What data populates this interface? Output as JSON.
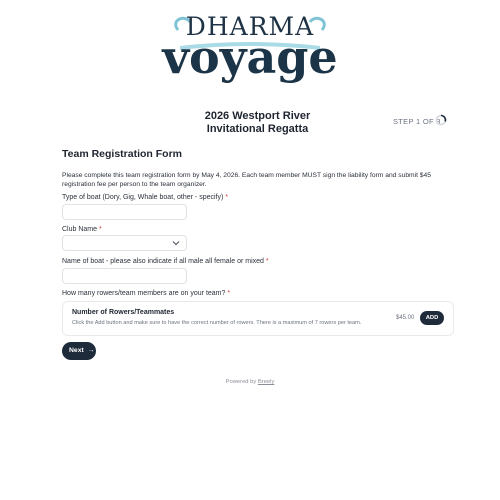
{
  "logo": {
    "line1": "DHARMA",
    "line2": "voyage"
  },
  "event": {
    "title_line1": "2026 Westport River",
    "title_line2": "Invitational Regatta"
  },
  "step": {
    "label": "STEP 1 OF 3"
  },
  "form": {
    "title": "Team Registration Form",
    "intro": "Please complete this team registration form by May 4, 2026. Each team member MUST sign the liability form and submit $45 registration fee per person to the team organizer.",
    "fields": {
      "boat_type": {
        "label": "Type of boat (Dory, Gig, Whale boat, other - specify)",
        "required_mark": "*",
        "value": ""
      },
      "club_name": {
        "label": "Club Name",
        "required_mark": "*",
        "value": ""
      },
      "boat_name": {
        "label": "Name of boat - please also indicate if all male all female or mixed",
        "required_mark": "*",
        "value": ""
      },
      "rowers": {
        "label": "How many rowers/team members are on your team?",
        "required_mark": "*"
      }
    },
    "rowers_card": {
      "title": "Number of Rowers/Teammates",
      "subtitle": "Click the Add button and make sure to have the correct number of rowers. There is a maximum of 7 rowers per team.",
      "price": "$45.00",
      "add_label": "ADD"
    },
    "next_label": "Next",
    "next_arrow": "→"
  },
  "footer": {
    "powered_text": "Powered by",
    "brand": "Breely"
  }
}
